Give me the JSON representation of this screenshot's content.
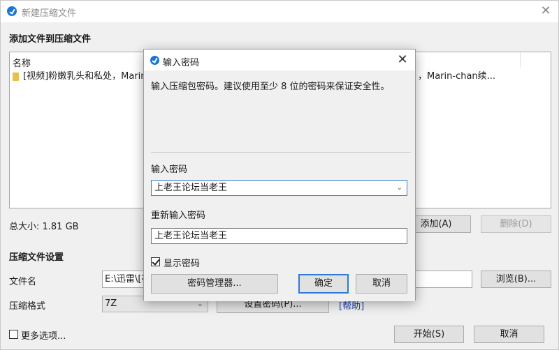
{
  "main_window": {
    "title": "新建压缩文件",
    "section_add": "添加文件到压缩文件",
    "list_header": "名称",
    "file_row_left": "[视频]粉嫩乳头和私处，Marin",
    "file_row_right": "，Marin-chan续...",
    "total_size": "总大小: 1.81 GB",
    "add_button": "添加(A)",
    "remove_button": "删除(D)",
    "section_settings": "压缩文件设置",
    "filename_label": "文件名",
    "filename_value": "E:\\迅雷\\[视",
    "browse_button": "浏览(B)...",
    "format_label": "压缩格式",
    "format_value": "7Z",
    "set_password_button": "设置密码(P)...",
    "help_link": "[帮助]",
    "more_options_label": "更多选项...",
    "start_button": "开始(S)",
    "cancel_button": "取消"
  },
  "dialog": {
    "title": "输入密码",
    "description": "输入压缩包密码。建议使用至少 8 位的密码来保证安全性。",
    "password_label": "输入密码",
    "password_value": "上老王论坛当老王",
    "reenter_label": "重新输入密码",
    "reenter_value": "上老王论坛当老王",
    "show_password_label": "显示密码",
    "show_password_checked": true,
    "password_manager_button": "密码管理器...",
    "ok_button": "确定",
    "cancel_button": "取消"
  },
  "colors": {
    "accent": "#2f7ad6",
    "link": "#1a3cb0",
    "app_icon": "#1677d9"
  },
  "icons": [
    "app-icon",
    "close-icon",
    "folder-icon",
    "chevron-down-icon",
    "checkbox-check-icon"
  ]
}
